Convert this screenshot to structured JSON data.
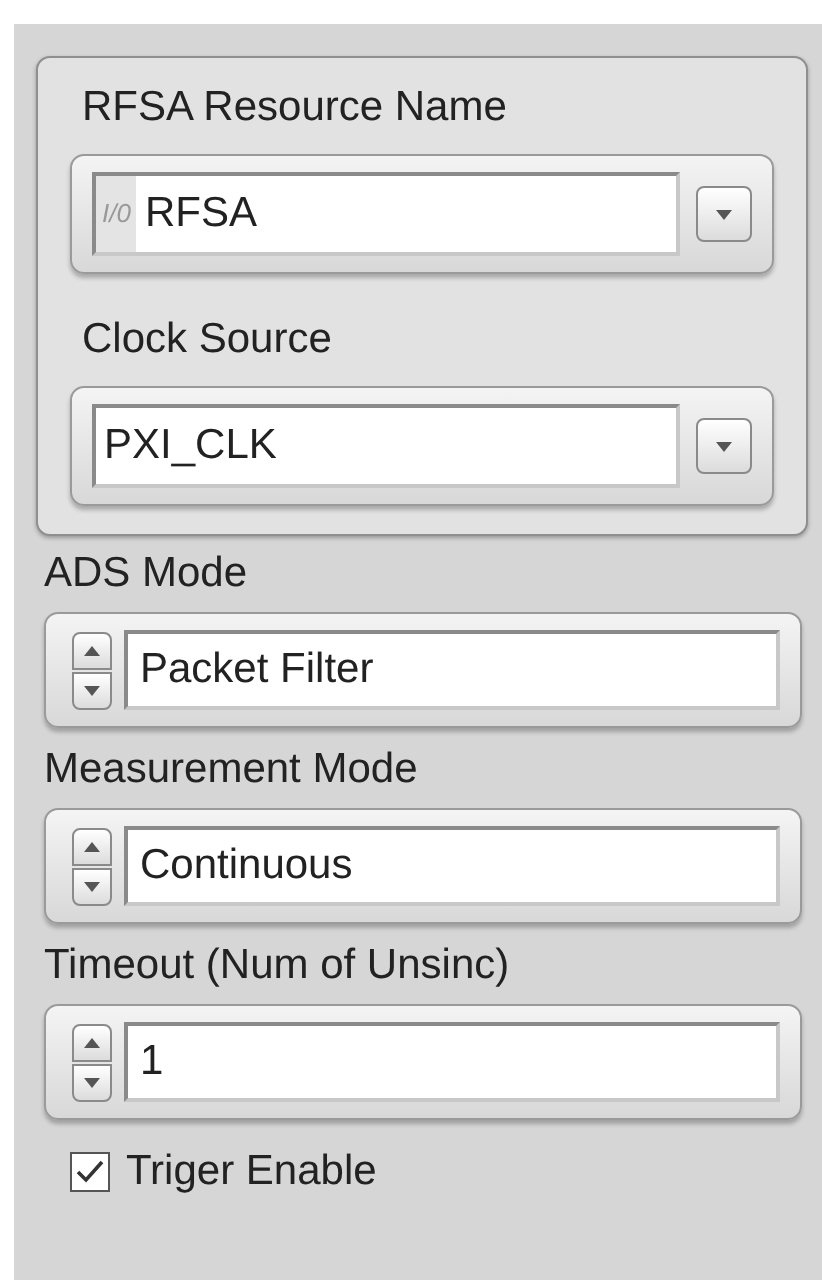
{
  "resource_group": [
    {
      "kind": "combo",
      "label": "RFSA Resource Name",
      "prefix": "I/0",
      "value": "RFSA"
    },
    {
      "kind": "combo",
      "label": "Clock Source",
      "value": "PXI_CLK"
    }
  ],
  "controls": [
    {
      "kind": "spin",
      "label": "ADS Mode",
      "value": "Packet Filter"
    },
    {
      "kind": "spin",
      "label": "Measurement Mode",
      "value": "Continuous"
    },
    {
      "kind": "spin",
      "label": "Timeout (Num of Unsinc)",
      "value": "1"
    }
  ],
  "checkbox": {
    "label": "Triger Enable",
    "checked": true
  }
}
